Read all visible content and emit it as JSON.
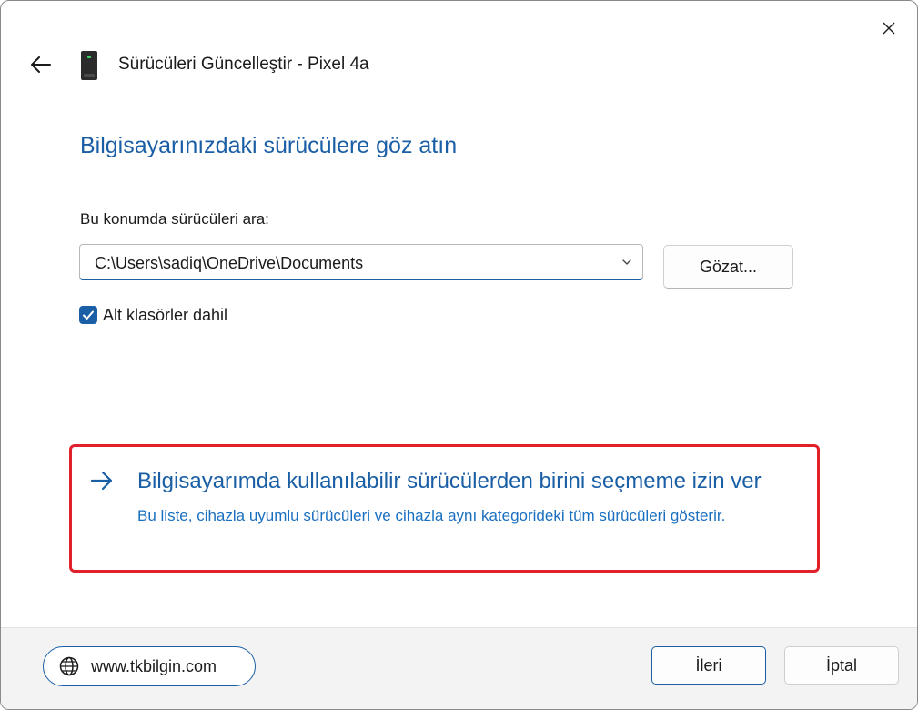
{
  "window": {
    "title": "Sürücüleri Güncelleştir - Pixel 4a",
    "close_icon": "close-icon",
    "back_icon": "back-arrow-icon",
    "device_icon": "phone-device-icon"
  },
  "main": {
    "heading": "Bilgisayarınızdaki sürücülere göz atın",
    "search_label": "Bu konumda sürücüleri ara:",
    "path_value": "C:\\Users\\sadiq\\OneDrive\\Documents",
    "browse_label": "Gözat...",
    "include_subfolders_label": "Alt klasörler dahil",
    "include_subfolders_checked": true
  },
  "choice": {
    "title": "Bilgisayarımda kullanılabilir sürücülerden birini seçmeme izin ver",
    "description": "Bu liste, cihazla uyumlu sürücüleri ve cihazla aynı kategorideki tüm sürücüleri gösterir.",
    "highlight_color": "#e0202b"
  },
  "footer": {
    "website": "www.tkbilgin.com",
    "next_label": "İleri",
    "cancel_label": "İptal"
  },
  "colors": {
    "accent": "#1a5fa6",
    "footer_bg": "#f3f3f3"
  }
}
